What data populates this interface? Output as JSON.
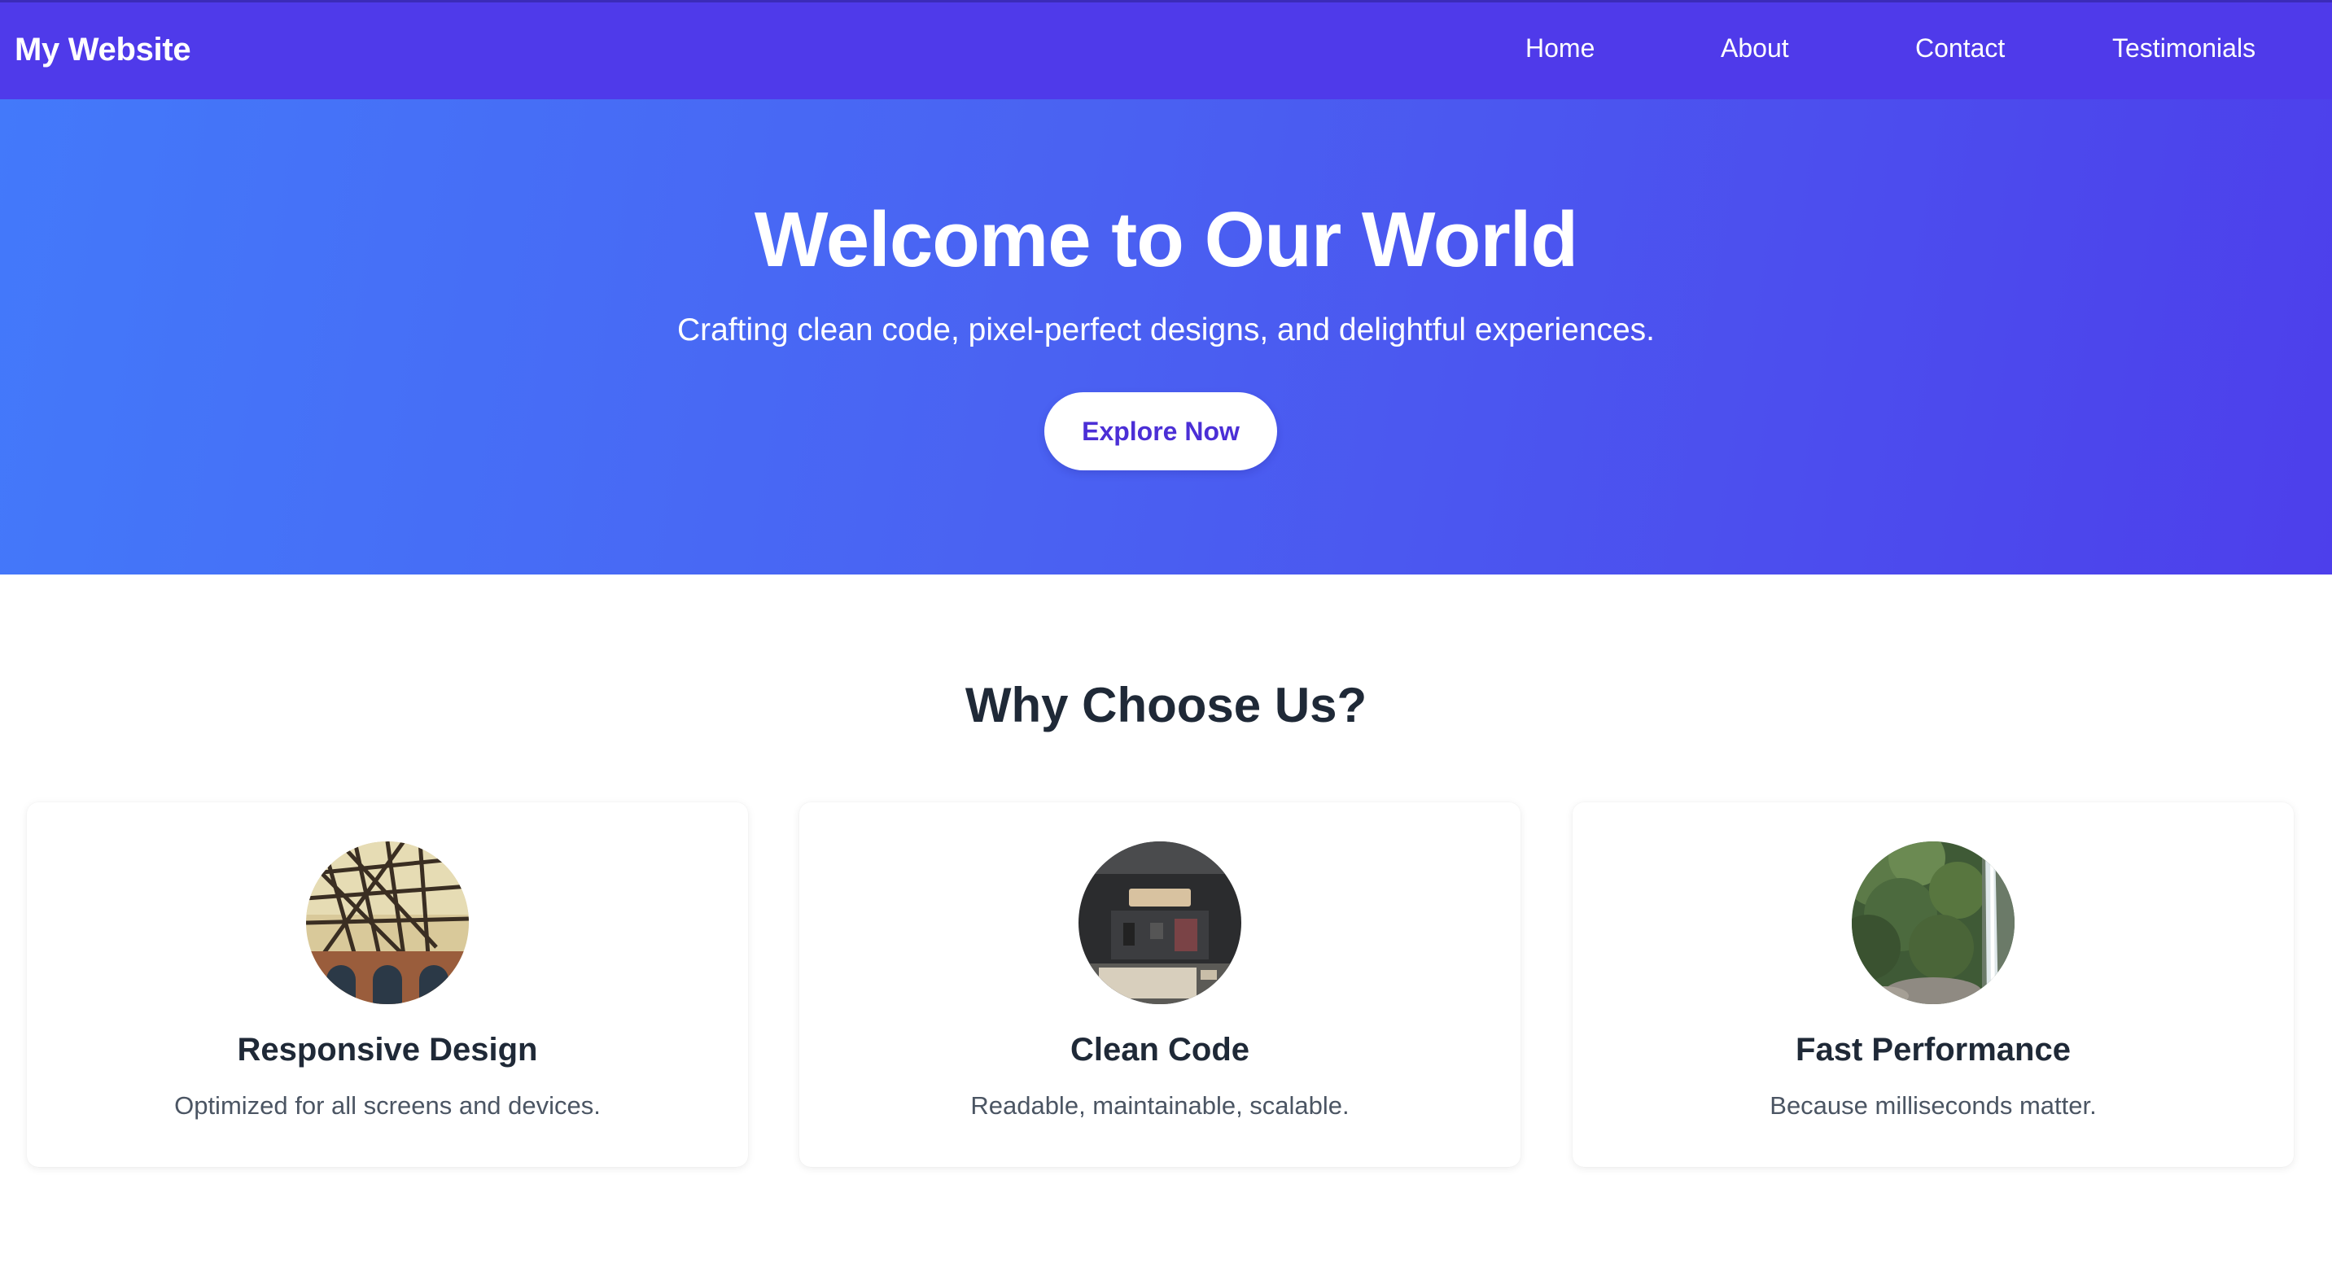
{
  "navbar": {
    "brand": "My Website",
    "links": [
      {
        "label": "Home"
      },
      {
        "label": "About"
      },
      {
        "label": "Contact"
      },
      {
        "label": "Testimonials"
      }
    ]
  },
  "hero": {
    "title": "Welcome to Our World",
    "subtitle": "Crafting clean code, pixel-perfect designs, and delightful experiences.",
    "cta_label": "Explore Now"
  },
  "features": {
    "title": "Why Choose Us?",
    "cards": [
      {
        "title": "Responsive Design",
        "description": "Optimized for all screens and devices.",
        "image": "architecture-photo"
      },
      {
        "title": "Clean Code",
        "description": "Readable, maintainable, scalable.",
        "image": "laptop-keyboard-photo"
      },
      {
        "title": "Fast Performance",
        "description": "Because milliseconds matter.",
        "image": "waterfall-photo"
      }
    ]
  },
  "colors": {
    "navbar_bg": "#4f3aea",
    "hero_gradient_start": "#4379fa",
    "hero_gradient_end": "#4d3feb",
    "cta_text": "#4b2fd6",
    "heading_text": "#1f2937",
    "body_text": "#4b5563"
  }
}
